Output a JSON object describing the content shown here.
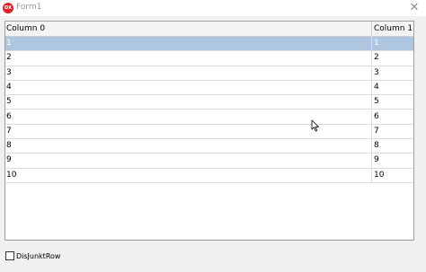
{
  "window": {
    "title": "Form1",
    "app_icon_text": "DX",
    "close_glyph": "✕"
  },
  "grid": {
    "columns": [
      "Column 0",
      "Column 1"
    ],
    "selected_row": 0,
    "rows": [
      [
        "1",
        "1"
      ],
      [
        "2",
        "2"
      ],
      [
        "3",
        "3"
      ],
      [
        "4",
        "4"
      ],
      [
        "5",
        "5"
      ],
      [
        "6",
        "6"
      ],
      [
        "7",
        "7"
      ],
      [
        "8",
        "8"
      ],
      [
        "9",
        "9"
      ],
      [
        "10",
        "10"
      ]
    ]
  },
  "options": {
    "disjunkt_label": "DisJunktRow",
    "disjunkt_checked": false
  },
  "colors": {
    "selection": "#aec6df",
    "app_icon": "#d9262c"
  }
}
